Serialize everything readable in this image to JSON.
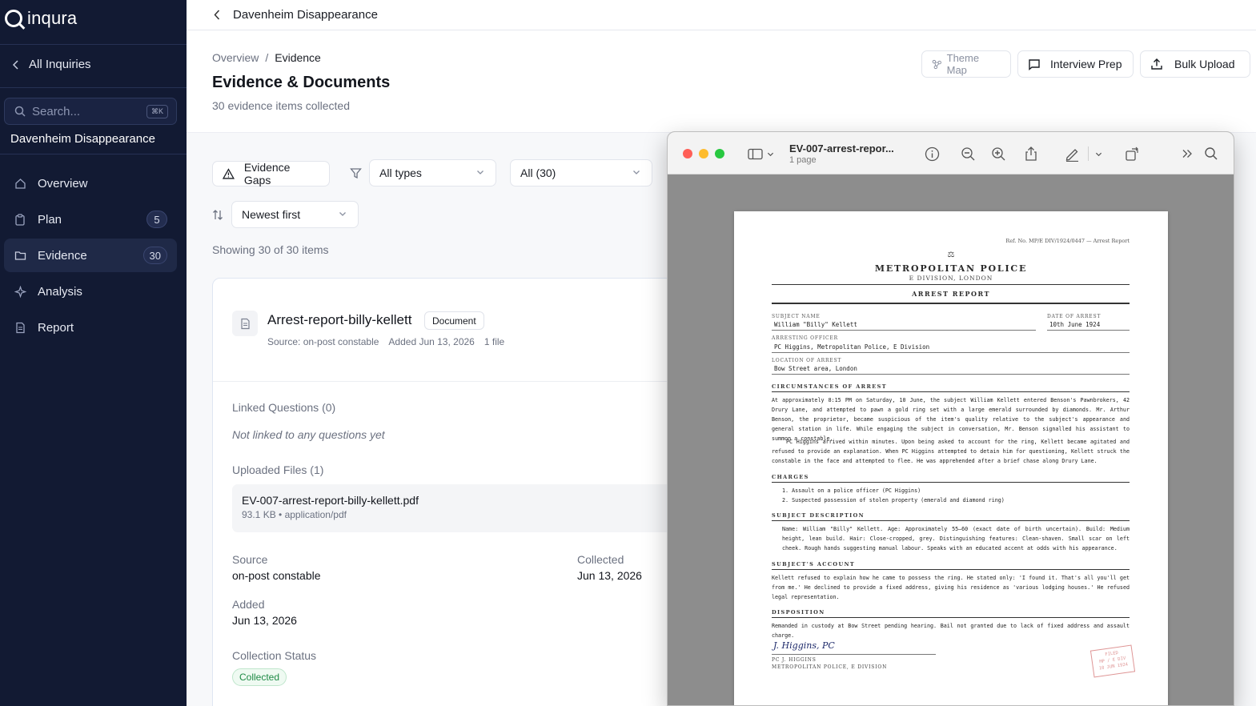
{
  "app": {
    "name": "inqura",
    "back_label": "All Inquiries",
    "search_placeholder": "Search...",
    "search_shortcut": "⌘K",
    "inquiry_name": "Davenheim Disappearance"
  },
  "nav": {
    "items": [
      {
        "label": "Overview",
        "icon": "home-icon",
        "badge": ""
      },
      {
        "label": "Plan",
        "icon": "clipboard-icon",
        "badge": "5"
      },
      {
        "label": "Evidence",
        "icon": "folder-icon",
        "badge": "30",
        "active": true
      },
      {
        "label": "Analysis",
        "icon": "sparkle-icon",
        "badge": ""
      },
      {
        "label": "Report",
        "icon": "document-icon",
        "badge": ""
      }
    ]
  },
  "topbar": {
    "title": "Davenheim Disappearance"
  },
  "header": {
    "breadcrumb": [
      "Overview",
      "/",
      "Evidence"
    ],
    "title": "Evidence & Documents",
    "subtitle": "30 evidence items collected",
    "buttons": {
      "theme_map": "Theme Map",
      "interview_prep": "Interview Prep",
      "bulk_upload": "Bulk Upload"
    }
  },
  "filters": {
    "evidence_gaps": "Evidence Gaps",
    "type_select": "All types",
    "count_select": "All (30)",
    "sort_select": "Newest first",
    "showing": "Showing 30 of 30 items"
  },
  "card": {
    "title": "Arrest-report-billy-kellett",
    "type": "Document",
    "source_meta": "Source: on-post constable",
    "added_meta": "Added Jun 13, 2026",
    "files_meta": "1 file",
    "linked_questions_label": "Linked Questions (0)",
    "linked_questions_empty": "Not linked to any questions yet",
    "uploaded_files_label": "Uploaded Files (1)",
    "file_name": "EV-007-arrest-report-billy-kellett.pdf",
    "file_meta": "93.1 KB • application/pdf",
    "source_label": "Source",
    "source_value": "on-post constable",
    "collected_label": "Collected",
    "collected_value": "Jun 13, 2026",
    "added_label": "Added",
    "added_value": "Jun 13, 2026",
    "status_label": "Collection Status",
    "status_value": "Collected",
    "status_color": "#1e8a45"
  },
  "preview": {
    "title": "EV-007-arrest-repor...",
    "pages": "1 page",
    "window_colors": {
      "close": "#ff5f57",
      "minimize": "#febc2e",
      "zoom": "#28c840"
    }
  },
  "report": {
    "ref": "Ref. No. MP/E DIV/1924/0447 — Arrest Report",
    "scale_glyph": "⚖",
    "org": "METROPOLITAN POLICE",
    "division": "E DIVISION, LONDON",
    "title": "ARREST REPORT",
    "subject_name_label": "SUBJECT NAME",
    "subject_name": "William \"Billy\" Kellett",
    "date_label": "DATE OF ARREST",
    "date": "10th June 1924",
    "officer_label": "ARRESTING OFFICER",
    "officer": "PC Higgins, Metropolitan Police, E Division",
    "location_label": "LOCATION OF ARREST",
    "location": "Bow Street area, London",
    "circ_heading": "CIRCUMSTANCES OF ARREST",
    "circ_p1": "At approximately 8:15 PM on Saturday, 10 June, the subject William Kellett entered Benson's Pawnbrokers, 42 Drury Lane, and attempted to pawn a gold ring set with a large emerald surrounded by diamonds. Mr. Arthur Benson, the proprietor, became suspicious of the item's quality relative to the subject's appearance and general station in life. While engaging the subject in conversation, Mr. Benson signalled his assistant to summon a constable.",
    "circ_p2": "PC Higgins arrived within minutes. Upon being asked to account for the ring, Kellett became agitated and refused to provide an explanation. When PC Higgins attempted to detain him for questioning, Kellett struck the constable in the face and attempted to flee. He was apprehended after a brief chase along Drury Lane.",
    "charges_heading": "CHARGES",
    "charge_1": "1. Assault on a police officer (PC Higgins)",
    "charge_2": "2. Suspected possession of stolen property (emerald and diamond ring)",
    "desc_heading": "SUBJECT DESCRIPTION",
    "desc": "Name: William \"Billy\" Kellett. Age: Approximately 55–60 (exact date of birth uncertain). Build: Medium height, lean build. Hair: Close-cropped, grey. Distinguishing features: Clean-shaven. Small scar on left cheek. Rough hands suggesting manual labour. Speaks with an educated accent at odds with his appearance.",
    "account_heading": "SUBJECT'S ACCOUNT",
    "account": "Kellett refused to explain how he came to possess the ring. He stated only: 'I found it. That's all you'll get from me.' He declined to provide a fixed address, giving his residence as 'various lodging houses.' He refused legal representation.",
    "disp_heading": "DISPOSITION",
    "disp": "Remanded in custody at Bow Street pending hearing. Bail not granted due to lack of fixed address and assault charge.",
    "signature": "J. Higgins, PC",
    "sig_name_1": "PC J. HIGGINS",
    "sig_name_2": "METROPOLITAN POLICE, E DIVISION",
    "stamp_1": "FILED",
    "stamp_2": "MP / E DIV",
    "stamp_3": "10 JUN 1924"
  }
}
